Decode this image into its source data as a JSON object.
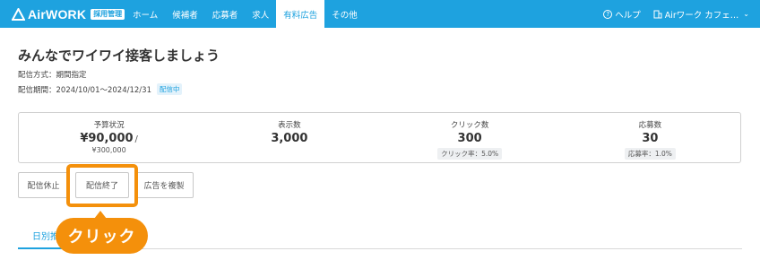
{
  "header": {
    "logo_text": "AirWORK",
    "logo_badge": "採用管理",
    "nav": [
      {
        "label": "ホーム",
        "active": false
      },
      {
        "label": "候補者",
        "active": false
      },
      {
        "label": "応募者",
        "active": false
      },
      {
        "label": "求人",
        "active": false
      },
      {
        "label": "有料広告",
        "active": true
      },
      {
        "label": "その他",
        "active": false
      }
    ],
    "help_label": "ヘルプ",
    "account_label": "Airワーク カフェ…"
  },
  "campaign": {
    "title": "みんなでワイワイ接客しましょう",
    "delivery_method": "配信方式：期間指定",
    "delivery_period": "配信期間：2024/10/01〜2024/12/31",
    "status": "配信中"
  },
  "stats": {
    "budget": {
      "label": "予算状況",
      "value": "¥90,000",
      "slash": "/",
      "total": "¥300,000"
    },
    "impressions": {
      "label": "表示数",
      "value": "3,000"
    },
    "clicks": {
      "label": "クリック数",
      "value": "300",
      "rate": "クリック率：5.0%"
    },
    "applications": {
      "label": "応募数",
      "value": "30",
      "rate": "応募率：1.0%"
    }
  },
  "actions": {
    "pause": "配信休止",
    "end": "配信終了",
    "copy": "広告を複製"
  },
  "tabs": {
    "active_label": "日別推移"
  },
  "callout": {
    "label": "クリック",
    "color": "#f4900b"
  },
  "colors": {
    "brand": "#1ea2df",
    "highlight": "#f4900b"
  }
}
